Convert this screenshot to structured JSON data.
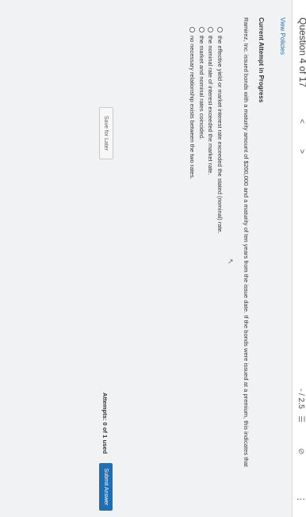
{
  "header": {
    "question_counter": "Question 4 of 17",
    "prev_glyph": "<",
    "next_glyph": ">",
    "score": "- / 2.5",
    "list_icon": "list-icon",
    "link_icon": "link-icon",
    "more_icon": "more-icon"
  },
  "view_policies": "View Policies",
  "status_title": "Current Attempt in Progress",
  "question_text": "Ramirez, Inc. issued bonds with a maturity amount of $200,000 and a maturity of ten years from the issue date. If the bonds were issued at a premium, this indicates that",
  "options": [
    {
      "label": "the effective yield or market interest rate exceeded the stated (nominal) rate."
    },
    {
      "label": "the nominal rate of interest exceeded the market rate."
    },
    {
      "label": "the market and nominal rates coincided."
    },
    {
      "label": "no necessary relationship exists between the two rates."
    }
  ],
  "attempts": "Attempts: 0 of 1 used",
  "submit_label": "Submit Answer",
  "save_label": "Save for Later",
  "colors": {
    "accent": "#1f6fb4",
    "link": "#2d6ea8"
  }
}
